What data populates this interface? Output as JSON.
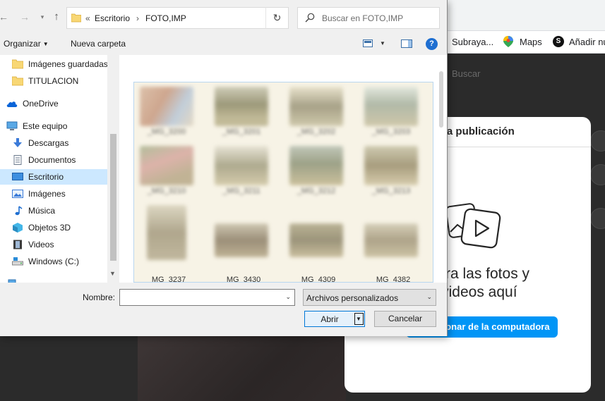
{
  "background": {
    "bookmarks": [
      {
        "label": "Subraya..."
      },
      {
        "label": "Maps",
        "icon": "maps-pin-icon"
      },
      {
        "label": "Añadir nu",
        "icon": "s-logo-icon"
      }
    ],
    "instagram": {
      "search_placeholder": "Buscar",
      "modal_title": "Nueva publicación",
      "drag_text_line1": "Arrastra las fotos y",
      "drag_text_line2": "los videos aquí",
      "select_button": "Seleccionar de la computadora",
      "accent_color": "#0095f6"
    }
  },
  "dialog": {
    "address": {
      "overflow_glyph": "«",
      "crumbs": [
        "Escritorio",
        "FOTO,IMP"
      ],
      "separator": "›"
    },
    "search": {
      "placeholder": "Buscar en FOTO,IMP"
    },
    "toolbar": {
      "organize": "Organizar",
      "new_folder": "Nueva carpeta"
    },
    "nav_items": [
      {
        "label": "Imágenes guardadas",
        "icon": "folder-icon"
      },
      {
        "label": "TITULACION",
        "icon": "folder-icon"
      },
      {
        "label": "OneDrive",
        "icon": "onedrive-cloud-icon"
      },
      {
        "label": "Este equipo",
        "icon": "computer-icon"
      },
      {
        "label": "Descargas",
        "icon": "download-arrow-icon"
      },
      {
        "label": "Documentos",
        "icon": "documents-icon"
      },
      {
        "label": "Escritorio",
        "icon": "desktop-icon",
        "selected": true
      },
      {
        "label": "Imágenes",
        "icon": "pictures-icon"
      },
      {
        "label": "Música",
        "icon": "music-note-icon"
      },
      {
        "label": "Objetos 3D",
        "icon": "cube-3d-icon"
      },
      {
        "label": "Videos",
        "icon": "film-icon"
      },
      {
        "label": "Windows (C:)",
        "icon": "drive-icon"
      }
    ],
    "files": [
      {
        "caption": "_MG_3237"
      },
      {
        "caption": "_MG_3430"
      },
      {
        "caption": "_MG_4309"
      },
      {
        "caption": "_MG_4382"
      }
    ],
    "footer": {
      "name_label": "Nombre:",
      "name_value": "",
      "file_type": "Archivos personalizados",
      "open": "Abrir",
      "cancel": "Cancelar"
    }
  }
}
